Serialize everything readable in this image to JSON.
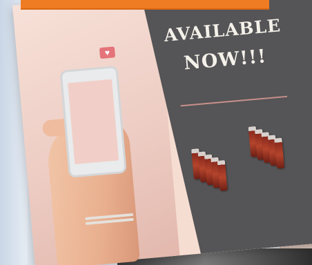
{
  "flyer": {
    "headline_line1": "AVAILABLE",
    "headline_line2": "NOW!!!"
  },
  "phone": {
    "screen_text": "",
    "notification_icon": "heart-icon"
  },
  "colors": {
    "banner": "#ef7c22",
    "flyer_pink": "#f6ddd2",
    "flyer_dark": "#555456",
    "bottle": "#a33a27"
  },
  "bottle_groups": [
    {
      "count": 5
    },
    {
      "count": 5
    }
  ]
}
